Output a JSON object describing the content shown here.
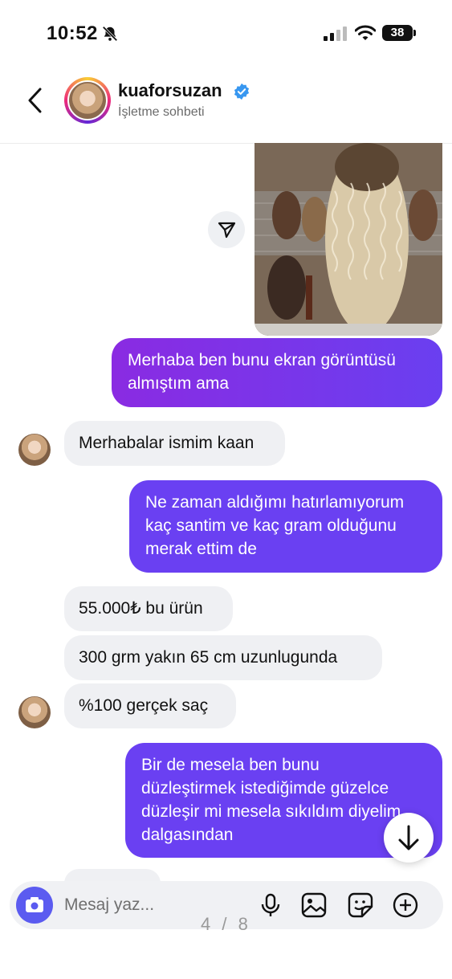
{
  "status_bar": {
    "time": "10:52",
    "battery": "38"
  },
  "header": {
    "username": "kuaforsuzan",
    "subtitle": "İşletme sohbeti"
  },
  "messages": [
    {
      "from": "me",
      "lines": [
        "Merhaba ben bunu ekran görüntüsü",
        "almıştım ama"
      ]
    },
    {
      "from": "them",
      "lines": [
        "Merhabalar ismim kaan"
      ]
    },
    {
      "from": "me",
      "lines": [
        "Ne zaman aldığımı hatırlamıyorum",
        "kaç santim ve kaç gram olduğunu",
        "merak ettim de"
      ]
    },
    {
      "from": "them",
      "lines": [
        "55.000₺ bu ürün"
      ]
    },
    {
      "from": "them",
      "lines": [
        "300 grm yakın 65 cm uzunlugunda"
      ]
    },
    {
      "from": "them",
      "lines": [
        "%100 gerçek saç"
      ]
    },
    {
      "from": "me",
      "lines": [
        "Bir de mesela ben bunu",
        "düzleştirmek istediğimde güzelce",
        "düzleşir mi mesela sıkıldım diyelim",
        "dalgasından"
      ]
    }
  ],
  "composer": {
    "placeholder": "Mesaj yaz..."
  },
  "pager": "4 / 8",
  "icons": [
    "back-chevron-icon",
    "verified-badge-icon",
    "share-icon",
    "camera-icon",
    "microphone-icon",
    "gallery-icon",
    "sticker-icon",
    "plus-icon",
    "arrow-down-icon"
  ],
  "colors": {
    "outgoing_start": "#8a2be2",
    "outgoing_end": "#6a3ff0",
    "incoming": "#eff0f3",
    "verified": "#3897f0"
  }
}
